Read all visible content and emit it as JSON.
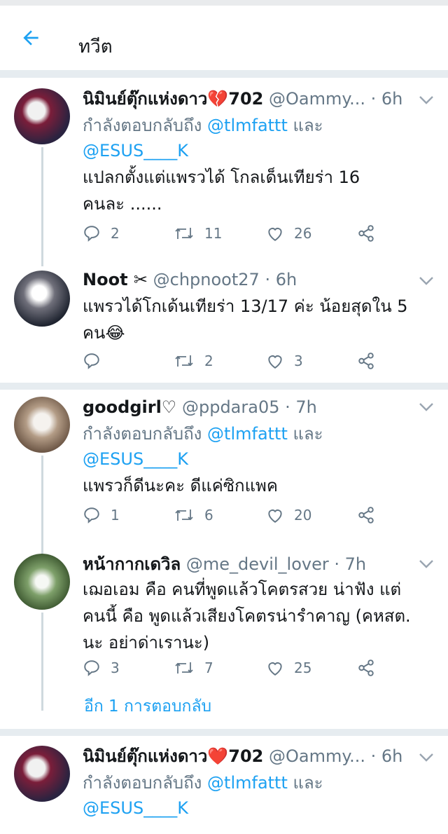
{
  "header": {
    "title": "ทวีต"
  },
  "tweets": [
    {
      "name": "นิมินย์ตุ๊กแห่งดาว💔702",
      "handle": "@Oammy...",
      "time": "· 6h",
      "reply_prefix": "กำลังตอบกลับถึง",
      "reply_user1": "@tlmfattt",
      "reply_and": " และ",
      "reply_user2": "@ESUS____K",
      "text1": "แปลกตั้งแต่แพรวได้ โกลเด็นเทียร่า 16",
      "text2": "คนละ ......",
      "replies": "2",
      "retweets": "11",
      "likes": "26"
    },
    {
      "name": "Noot ✂",
      "handle": "@chpnoot27",
      "time": "· 6h",
      "text1": "แพรวได้โกเด้นเทียร่า 13/17 ค่ะ น้อยสุดใน 5",
      "text2": "คน😂",
      "replies": "",
      "retweets": "2",
      "likes": "3"
    },
    {
      "name": "goodgirl♡",
      "handle": "@ppdara05",
      "time": "· 7h",
      "reply_prefix": "กำลังตอบกลับถึง",
      "reply_user1": "@tlmfattt",
      "reply_and": " และ",
      "reply_user2": "@ESUS____K",
      "text1": "แพรวก็ดีนะคะ ดีแค่ซิกแพค",
      "replies": "1",
      "retweets": "6",
      "likes": "20"
    },
    {
      "name": "หน้ากากเดวิล",
      "handle": "@me_devil_lover",
      "time": "· 7h",
      "text1": "เฌอเอม คือ คนที่พูดแล้วโคตรสวย น่าฟัง แต่",
      "text2": "คนนี้ คือ พูดแล้วเสียงโคตรน่ารำคาญ (คหสต.",
      "text3": "นะ อย่าด่าเรานะ)",
      "replies": "3",
      "retweets": "7",
      "likes": "25",
      "more_replies": "อีก 1 การตอบกลับ"
    },
    {
      "name": "นิมินย์ตุ๊กแห่งดาว❤️702",
      "handle": "@Oammy...",
      "time": "· 6h",
      "reply_prefix": "กำลังตอบกลับถึง",
      "reply_user1": "@tlmfattt",
      "reply_and": " และ",
      "reply_user2": "@ESUS____K"
    }
  ],
  "icons": {
    "back": "arrow-left-icon",
    "reply": "reply-icon",
    "retweet": "retweet-icon",
    "like": "heart-icon",
    "share": "share-icon",
    "caret": "chevron-down-icon"
  },
  "colors": {
    "accent": "#1da1f2",
    "muted": "#657786",
    "divider": "#e6ecf0"
  }
}
